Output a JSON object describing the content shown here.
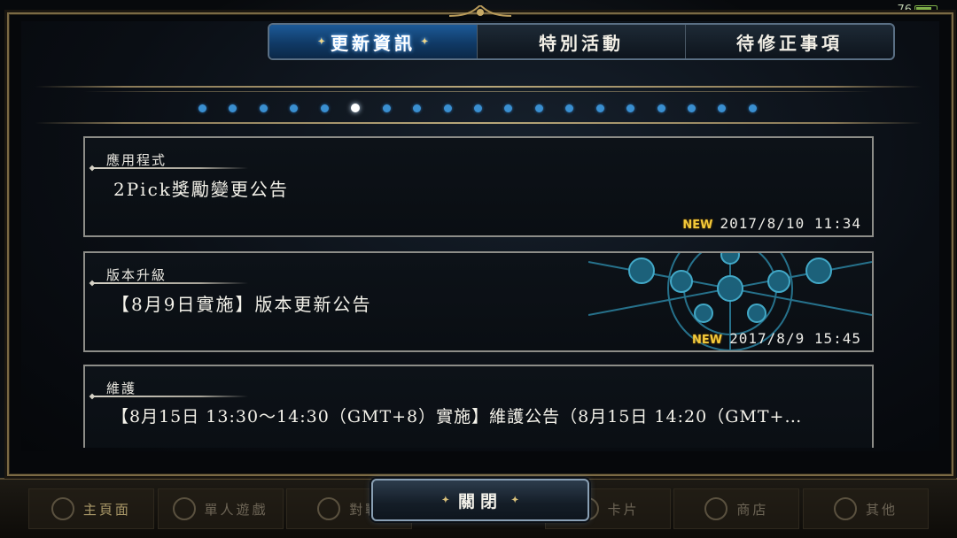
{
  "status_bar": {
    "battery": "76"
  },
  "tabs": [
    {
      "label": "更新資訊",
      "active": true
    },
    {
      "label": "特別活動",
      "active": false
    },
    {
      "label": "待修正事項",
      "active": false
    }
  ],
  "pager": {
    "total": 19,
    "current": 6
  },
  "news": [
    {
      "category": "應用程式",
      "title": "2Pick獎勵變更公告",
      "badge": "NEW",
      "timestamp": "2017/8/10 11:34"
    },
    {
      "category": "版本升級",
      "title": "【8月9日實施】版本更新公告",
      "badge": "NEW",
      "timestamp": "2017/8/9 15:45"
    },
    {
      "category": "維護",
      "title": "【8月15日 13:30～14:30（GMT+8）實施】維護公告（8月15日 14:20（GMT+…",
      "badge": "",
      "timestamp": ""
    }
  ],
  "bottom_nav": [
    "主頁面",
    "單人遊戲",
    "對戰",
    "卡片",
    "商店",
    "其他"
  ],
  "close_button": {
    "label": "關閉"
  },
  "colors": {
    "accent_blue": "#1c5a98",
    "new_badge": "#f3c93a",
    "frame_gold": "#7b6a45"
  }
}
